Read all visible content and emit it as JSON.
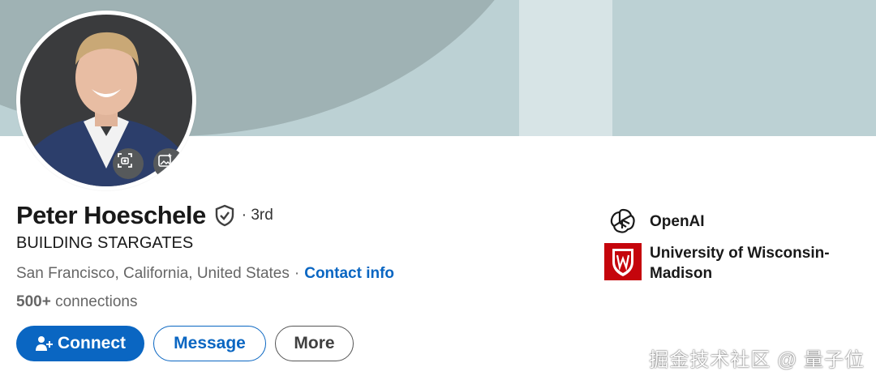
{
  "profile": {
    "name": "Peter Hoeschele",
    "degree": "· 3rd",
    "headline": "BUILDING STARGATES",
    "location": "San Francisco, California, United States",
    "separator": "·",
    "contact_label": "Contact info",
    "connections_count": "500+",
    "connections_label": "connections"
  },
  "actions": {
    "connect": "Connect",
    "message": "Message",
    "more": "More"
  },
  "organizations": [
    {
      "name": "OpenAI",
      "icon": "openai-logo-icon"
    },
    {
      "name": "University of Wisconsin-Madison",
      "icon": "uw-madison-crest-icon"
    }
  ],
  "watermark": "掘金技术社区 @ 量子位",
  "colors": {
    "accent": "#0a66c2",
    "banner": "#bcd1d4",
    "banner_arc": "#9fb2b4",
    "uw_red": "#c5050c"
  }
}
